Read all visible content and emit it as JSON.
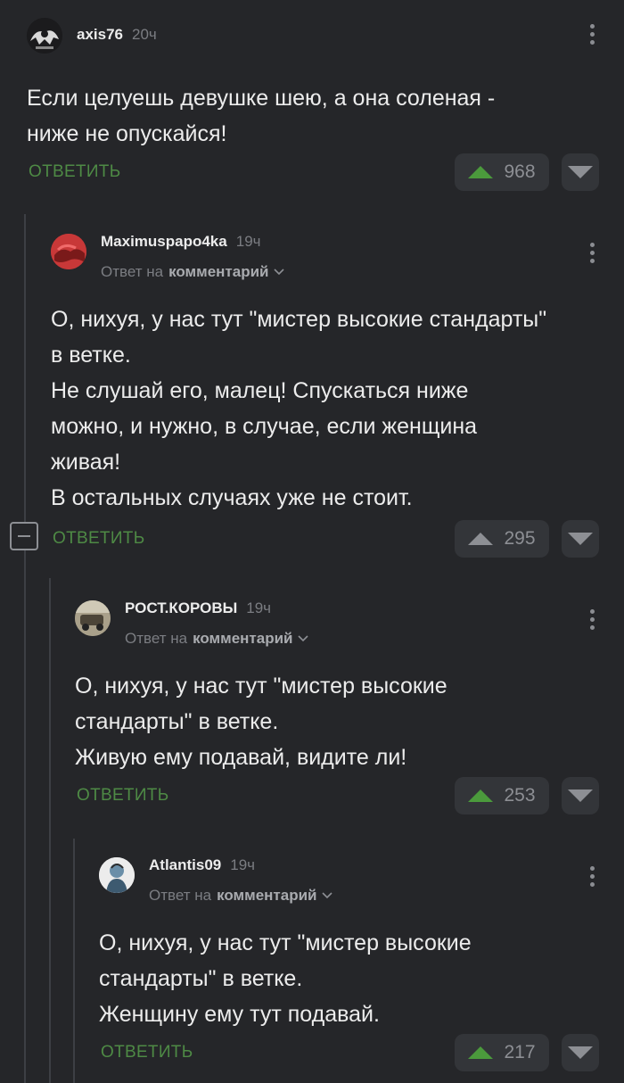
{
  "comments": [
    {
      "username": "axis76",
      "time": "20ч",
      "reply_prefix": "",
      "reply_target": "",
      "lines": [
        "Если целуешь девушке шею, а она соленая -",
        "ниже не опускайся!"
      ],
      "reply_label": "ОТВЕТИТЬ",
      "votes": "968",
      "upvoted": true
    },
    {
      "username": "Maximuspapo4ka",
      "time": "19ч",
      "reply_prefix": "Ответ на",
      "reply_target": "комментарий",
      "lines": [
        "О, нихуя, у нас тут \"мистер высокие стандарты\"",
        "в ветке.",
        "Не слушай его, малец! Спускаться ниже",
        "можно, и нужно, в случае, если женщина",
        "живая!",
        "В остальных случаях уже не стоит."
      ],
      "reply_label": "ОТВЕТИТЬ",
      "votes": "295",
      "upvoted": false
    },
    {
      "username": "РОСТ.КОРОВЫ",
      "time": "19ч",
      "reply_prefix": "Ответ на",
      "reply_target": "комментарий",
      "lines": [
        "О, нихуя, у нас тут \"мистер высокие",
        "стандарты\" в ветке.",
        "Живую ему подавай, видите ли!"
      ],
      "reply_label": "ОТВЕТИТЬ",
      "votes": "253",
      "upvoted": true
    },
    {
      "username": "Atlantis09",
      "time": "19ч",
      "reply_prefix": "Ответ на",
      "reply_target": "комментарий",
      "lines": [
        "О, нихуя, у нас тут \"мистер высокие",
        "стандарты\" в ветке.",
        "Женщину ему тут подавай."
      ],
      "reply_label": "ОТВЕТИТЬ",
      "votes": "217",
      "upvoted": true
    }
  ],
  "colors": {
    "background": "#252629",
    "accent_green": "#4e8a45",
    "upvote_green": "#4b9a3c",
    "muted": "#7b7d82"
  },
  "icons": [
    "more-vertical-icon",
    "chevron-down-icon",
    "upvote-icon",
    "downvote-icon",
    "collapse-thread-icon"
  ]
}
